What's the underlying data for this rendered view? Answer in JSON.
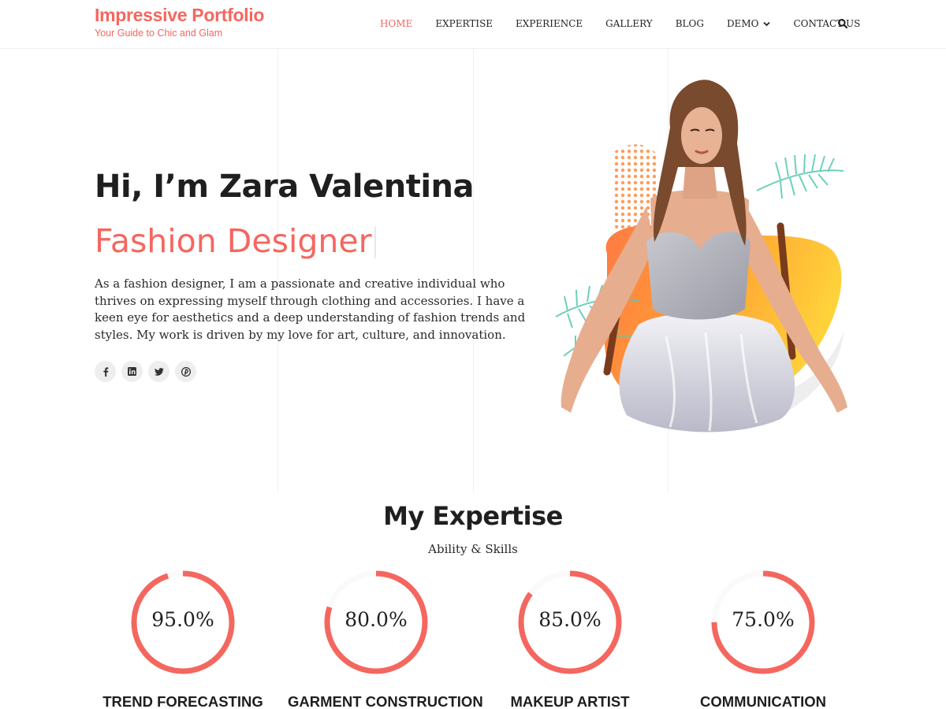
{
  "brand": {
    "title": "Impressive Portfolio",
    "tagline": "Your Guide to Chic and Glam"
  },
  "nav": {
    "items": [
      {
        "label": "HOME",
        "active": true
      },
      {
        "label": "EXPERTISE",
        "active": false
      },
      {
        "label": "EXPERIENCE",
        "active": false
      },
      {
        "label": "GALLERY",
        "active": false
      },
      {
        "label": "BLOG",
        "active": false
      },
      {
        "label": "DEMO",
        "active": false,
        "has_dropdown": true
      },
      {
        "label": "CONTACT US",
        "active": false
      }
    ],
    "search_icon": "search-icon"
  },
  "hero": {
    "title": "Hi, I’m Zara Valentina",
    "subtitle": "Fashion Designer",
    "text": "As a fashion designer, I am a passionate and creative individual who thrives on expressing myself through clothing and accessories. I have a keen eye for aesthetics and a deep understanding of fashion trends and styles. My work is driven by my love for art, culture, and innovation.",
    "socials": [
      "facebook-icon",
      "linkedin-icon",
      "twitter-icon",
      "pinterest-icon"
    ],
    "image": "woman-in-silver-dress-photo"
  },
  "expertise": {
    "title": "My Expertise",
    "subtitle": "Ability & Skills",
    "skills": [
      {
        "value": "95.0%",
        "percent": 95,
        "label": "TREND FORECASTING"
      },
      {
        "value": "80.0%",
        "percent": 80,
        "label": "GARMENT CONSTRUCTION"
      },
      {
        "value": "85.0%",
        "percent": 85,
        "label": "MAKEUP ARTIST"
      },
      {
        "value": "75.0%",
        "percent": 75,
        "label": "COMMUNICATION"
      }
    ]
  },
  "colors": {
    "accent": "#f4675f",
    "text": "#1f1f1f",
    "icon_bg": "#eeeeee"
  }
}
